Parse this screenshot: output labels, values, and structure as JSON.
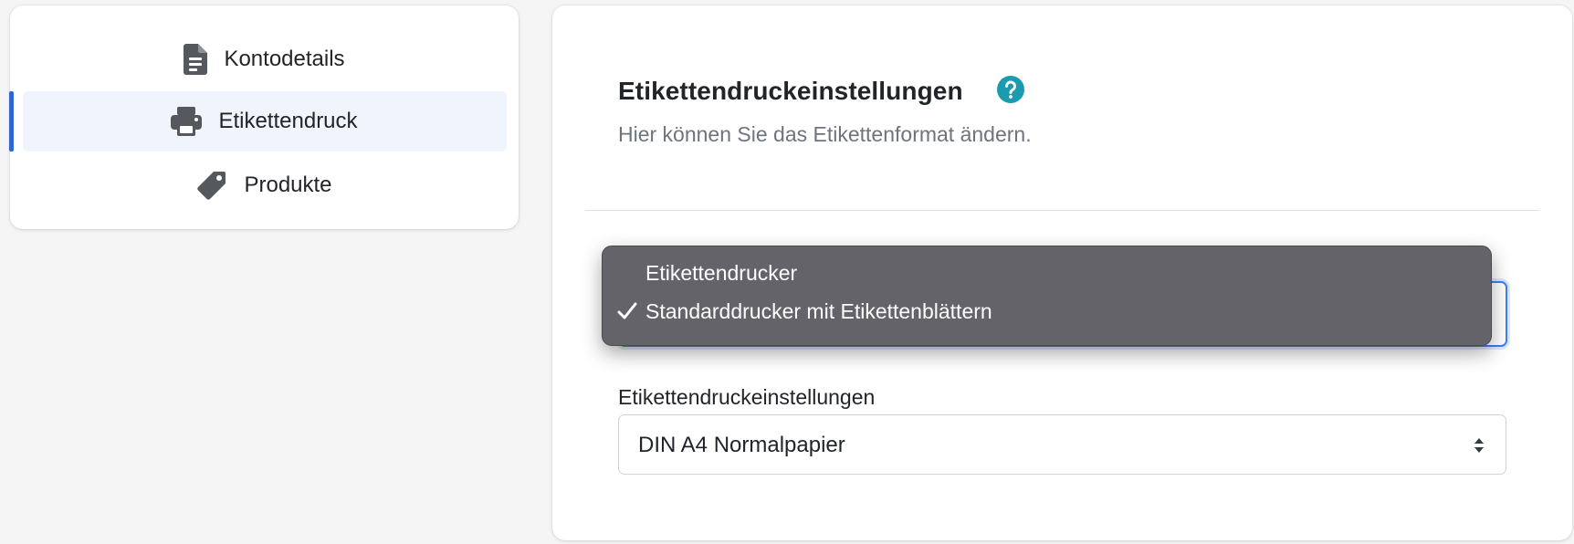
{
  "sidebar": {
    "items": [
      {
        "label": "Kontodetails",
        "icon": "document-icon",
        "active": false
      },
      {
        "label": "Etikettendruck",
        "icon": "printer-icon",
        "active": true
      },
      {
        "label": "Produkte",
        "icon": "tag-icon",
        "active": false
      }
    ]
  },
  "main": {
    "title": "Etikettendruckeinstellungen",
    "help_icon": "question-circle-icon",
    "subtitle": "Hier können Sie das Etikettenformat ändern.",
    "printer_select": {
      "options": [
        "Etikettendrucker",
        "Standarddrucker mit Etikettenblättern"
      ],
      "selected": "Standarddrucker mit Etikettenblättern"
    },
    "settings_field": {
      "label": "Etikettendruckeinstellungen",
      "value": "DIN A4 Normalpapier"
    }
  },
  "colors": {
    "accent": "#2f66d2",
    "help_icon": "#1a9bb0",
    "active_bg": "#eff4fd",
    "menu_bg": "#636369"
  }
}
